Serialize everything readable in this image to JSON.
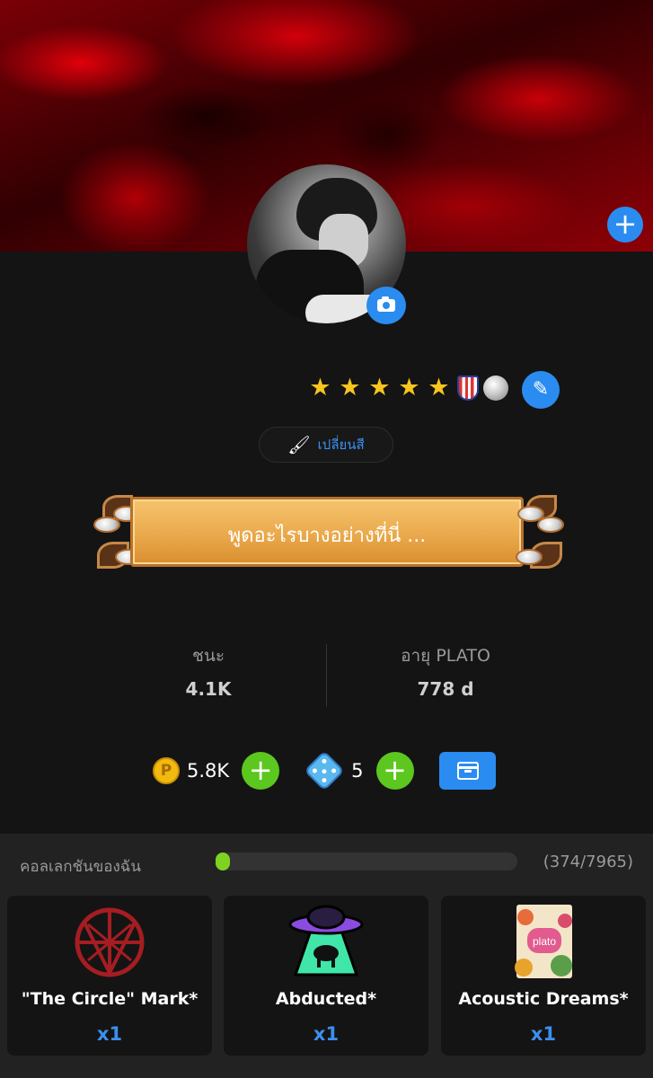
{
  "profile": {
    "change_color_label": "เปลี่ยนสี",
    "status_placeholder": "พูดอะไรบางอย่างที่นี่ ..."
  },
  "stats": [
    {
      "label": "ชนะ",
      "value": "4.1K"
    },
    {
      "label": "อายุ PLATO",
      "value": "778 d"
    }
  ],
  "wallet": {
    "coins": "5.8K",
    "dice": "5"
  },
  "badges": {
    "stars": 5,
    "icons": [
      "star-icon",
      "shield-badge-icon",
      "diamond-badge-icon"
    ]
  },
  "collection": {
    "title": "คอลเลกชันของฉัน",
    "count": "(374/7965)",
    "progress_fraction": 0.047,
    "items": [
      {
        "name": "\"The Circle\" Mark*",
        "qty": "x1"
      },
      {
        "name": "Abducted*",
        "qty": "x1"
      },
      {
        "name": "Acoustic Dreams*",
        "qty": "x1",
        "art_text": "plato"
      }
    ]
  },
  "colors": {
    "accent_blue": "#2a8cf0",
    "green": "#5cc71f",
    "background": "#141414"
  }
}
